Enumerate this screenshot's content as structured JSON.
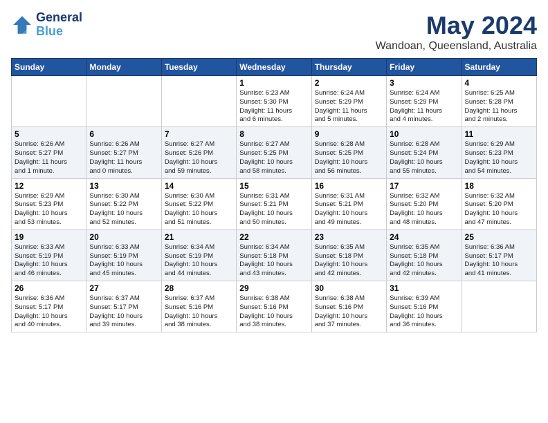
{
  "header": {
    "logo_line1": "General",
    "logo_line2": "Blue",
    "month": "May 2024",
    "location": "Wandoan, Queensland, Australia"
  },
  "days_of_week": [
    "Sunday",
    "Monday",
    "Tuesday",
    "Wednesday",
    "Thursday",
    "Friday",
    "Saturday"
  ],
  "weeks": [
    [
      {
        "day": "",
        "info": ""
      },
      {
        "day": "",
        "info": ""
      },
      {
        "day": "",
        "info": ""
      },
      {
        "day": "1",
        "info": "Sunrise: 6:23 AM\nSunset: 5:30 PM\nDaylight: 11 hours\nand 6 minutes."
      },
      {
        "day": "2",
        "info": "Sunrise: 6:24 AM\nSunset: 5:29 PM\nDaylight: 11 hours\nand 5 minutes."
      },
      {
        "day": "3",
        "info": "Sunrise: 6:24 AM\nSunset: 5:29 PM\nDaylight: 11 hours\nand 4 minutes."
      },
      {
        "day": "4",
        "info": "Sunrise: 6:25 AM\nSunset: 5:28 PM\nDaylight: 11 hours\nand 2 minutes."
      }
    ],
    [
      {
        "day": "5",
        "info": "Sunrise: 6:26 AM\nSunset: 5:27 PM\nDaylight: 11 hours\nand 1 minute."
      },
      {
        "day": "6",
        "info": "Sunrise: 6:26 AM\nSunset: 5:27 PM\nDaylight: 11 hours\nand 0 minutes."
      },
      {
        "day": "7",
        "info": "Sunrise: 6:27 AM\nSunset: 5:26 PM\nDaylight: 10 hours\nand 59 minutes."
      },
      {
        "day": "8",
        "info": "Sunrise: 6:27 AM\nSunset: 5:25 PM\nDaylight: 10 hours\nand 58 minutes."
      },
      {
        "day": "9",
        "info": "Sunrise: 6:28 AM\nSunset: 5:25 PM\nDaylight: 10 hours\nand 56 minutes."
      },
      {
        "day": "10",
        "info": "Sunrise: 6:28 AM\nSunset: 5:24 PM\nDaylight: 10 hours\nand 55 minutes."
      },
      {
        "day": "11",
        "info": "Sunrise: 6:29 AM\nSunset: 5:23 PM\nDaylight: 10 hours\nand 54 minutes."
      }
    ],
    [
      {
        "day": "12",
        "info": "Sunrise: 6:29 AM\nSunset: 5:23 PM\nDaylight: 10 hours\nand 53 minutes."
      },
      {
        "day": "13",
        "info": "Sunrise: 6:30 AM\nSunset: 5:22 PM\nDaylight: 10 hours\nand 52 minutes."
      },
      {
        "day": "14",
        "info": "Sunrise: 6:30 AM\nSunset: 5:22 PM\nDaylight: 10 hours\nand 51 minutes."
      },
      {
        "day": "15",
        "info": "Sunrise: 6:31 AM\nSunset: 5:21 PM\nDaylight: 10 hours\nand 50 minutes."
      },
      {
        "day": "16",
        "info": "Sunrise: 6:31 AM\nSunset: 5:21 PM\nDaylight: 10 hours\nand 49 minutes."
      },
      {
        "day": "17",
        "info": "Sunrise: 6:32 AM\nSunset: 5:20 PM\nDaylight: 10 hours\nand 48 minutes."
      },
      {
        "day": "18",
        "info": "Sunrise: 6:32 AM\nSunset: 5:20 PM\nDaylight: 10 hours\nand 47 minutes."
      }
    ],
    [
      {
        "day": "19",
        "info": "Sunrise: 6:33 AM\nSunset: 5:19 PM\nDaylight: 10 hours\nand 46 minutes."
      },
      {
        "day": "20",
        "info": "Sunrise: 6:33 AM\nSunset: 5:19 PM\nDaylight: 10 hours\nand 45 minutes."
      },
      {
        "day": "21",
        "info": "Sunrise: 6:34 AM\nSunset: 5:19 PM\nDaylight: 10 hours\nand 44 minutes."
      },
      {
        "day": "22",
        "info": "Sunrise: 6:34 AM\nSunset: 5:18 PM\nDaylight: 10 hours\nand 43 minutes."
      },
      {
        "day": "23",
        "info": "Sunrise: 6:35 AM\nSunset: 5:18 PM\nDaylight: 10 hours\nand 42 minutes."
      },
      {
        "day": "24",
        "info": "Sunrise: 6:35 AM\nSunset: 5:18 PM\nDaylight: 10 hours\nand 42 minutes."
      },
      {
        "day": "25",
        "info": "Sunrise: 6:36 AM\nSunset: 5:17 PM\nDaylight: 10 hours\nand 41 minutes."
      }
    ],
    [
      {
        "day": "26",
        "info": "Sunrise: 6:36 AM\nSunset: 5:17 PM\nDaylight: 10 hours\nand 40 minutes."
      },
      {
        "day": "27",
        "info": "Sunrise: 6:37 AM\nSunset: 5:17 PM\nDaylight: 10 hours\nand 39 minutes."
      },
      {
        "day": "28",
        "info": "Sunrise: 6:37 AM\nSunset: 5:16 PM\nDaylight: 10 hours\nand 38 minutes."
      },
      {
        "day": "29",
        "info": "Sunrise: 6:38 AM\nSunset: 5:16 PM\nDaylight: 10 hours\nand 38 minutes."
      },
      {
        "day": "30",
        "info": "Sunrise: 6:38 AM\nSunset: 5:16 PM\nDaylight: 10 hours\nand 37 minutes."
      },
      {
        "day": "31",
        "info": "Sunrise: 6:39 AM\nSunset: 5:16 PM\nDaylight: 10 hours\nand 36 minutes."
      },
      {
        "day": "",
        "info": ""
      }
    ]
  ]
}
